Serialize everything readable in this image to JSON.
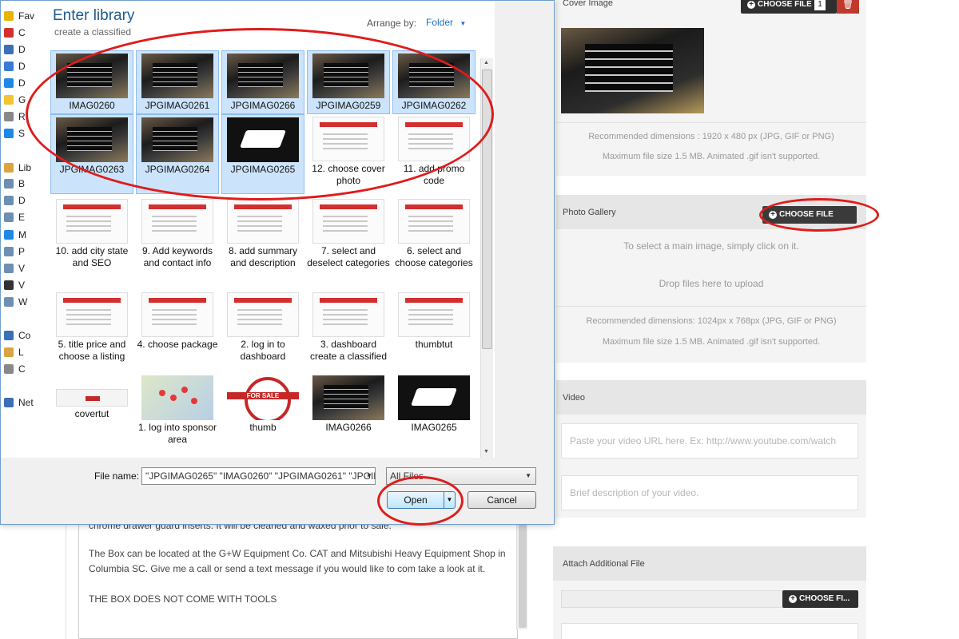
{
  "dialog": {
    "title": "Enter library",
    "subtitle": "create a classified",
    "arrange_label": "Arrange by:",
    "arrange_value": "Folder",
    "file_name_label": "File name:",
    "file_name_value": "\"JPGIMAG0265\" \"IMAG0260\" \"JPGIMAG0261\" \"JPGIM",
    "file_type_value": "All Files",
    "open_label": "Open",
    "cancel_label": "Cancel",
    "files": [
      {
        "label": "IMAG0260",
        "kind": "photo",
        "selected": true
      },
      {
        "label": "JPGIMAG0261",
        "kind": "photo",
        "selected": true
      },
      {
        "label": "JPGIMAG0266",
        "kind": "photo",
        "selected": true
      },
      {
        "label": "JPGIMAG0259",
        "kind": "photo",
        "selected": true
      },
      {
        "label": "JPGIMAG0262",
        "kind": "photo",
        "selected": true
      },
      {
        "label": "JPGIMAG0263",
        "kind": "photo",
        "selected": true
      },
      {
        "label": "JPGIMAG0264",
        "kind": "photo",
        "selected": true
      },
      {
        "label": "JPGIMAG0265",
        "kind": "logo",
        "selected": true
      },
      {
        "label": "12. choose cover photo",
        "kind": "shot",
        "selected": false
      },
      {
        "label": "11. add promo code",
        "kind": "shot",
        "selected": false
      },
      {
        "label": "10. add city state and SEO",
        "kind": "shot",
        "selected": false
      },
      {
        "label": "9. Add keywords and contact info",
        "kind": "shot",
        "selected": false
      },
      {
        "label": "8. add summary and description",
        "kind": "shot",
        "selected": false
      },
      {
        "label": "7. select and deselect categories",
        "kind": "shot",
        "selected": false
      },
      {
        "label": "6. select and choose categories",
        "kind": "shot",
        "selected": false
      },
      {
        "label": "5. title price and choose a listing",
        "kind": "shot",
        "selected": false
      },
      {
        "label": "4. choose package",
        "kind": "shot",
        "selected": false
      },
      {
        "label": "2. log in to dashboard",
        "kind": "shot",
        "selected": false
      },
      {
        "label": "3. dashboard create a classified",
        "kind": "shot",
        "selected": false
      },
      {
        "label": "thumbtut",
        "kind": "shot",
        "selected": false
      },
      {
        "label": "covertut",
        "kind": "wide",
        "selected": false
      },
      {
        "label": "1. log into sponsor area",
        "kind": "map",
        "selected": false
      },
      {
        "label": "thumb",
        "kind": "stamp",
        "selected": false
      },
      {
        "label": "IMAG0266",
        "kind": "photo",
        "selected": false
      },
      {
        "label": "IMAG0265",
        "kind": "logo",
        "selected": false
      }
    ],
    "stamp_text": "FOR SALE"
  },
  "sidebar": {
    "items": [
      {
        "label": "Fav",
        "color": "#e8b400"
      },
      {
        "label": "C",
        "color": "#d32f2f"
      },
      {
        "label": "D",
        "color": "#3b6fb6"
      },
      {
        "label": "D",
        "color": "#3a7bd5"
      },
      {
        "label": "D",
        "color": "#1e88e5"
      },
      {
        "label": "G",
        "color": "#f4c430"
      },
      {
        "label": "R",
        "color": "#888888"
      },
      {
        "label": "S",
        "color": "#1e88e5"
      },
      {
        "label": "Lib",
        "color": "#d9a441"
      },
      {
        "label": "B",
        "color": "#6d8fb3"
      },
      {
        "label": "D",
        "color": "#6d8fb3"
      },
      {
        "label": "E",
        "color": "#6d8fb3"
      },
      {
        "label": "M",
        "color": "#1e88e5"
      },
      {
        "label": "P",
        "color": "#6d8fb3"
      },
      {
        "label": "V",
        "color": "#6d8fb3"
      },
      {
        "label": "V",
        "color": "#333333"
      },
      {
        "label": "W",
        "color": "#6d8fb3"
      },
      {
        "label": "Co",
        "color": "#3b6fb6"
      },
      {
        "label": "L",
        "color": "#d9a441"
      },
      {
        "label": "C",
        "color": "#888888"
      },
      {
        "label": "Net",
        "color": "#3b6fb6"
      }
    ]
  },
  "form": {
    "cover_image_title": "Cover Image",
    "cover_choose_label": "CHOOSE FILE",
    "cover_count": "1",
    "cover_recommended": "Recommended dimensions : 1920 x 480 px (JPG, GIF or PNG)",
    "cover_max": "Maximum file size 1.5 MB. Animated .gif isn't supported.",
    "gallery_title": "Photo Gallery",
    "gallery_choose_label": "CHOOSE FILE",
    "gallery_hint": "To select a main image, simply click on it.",
    "gallery_drop": "Drop files here to upload",
    "gallery_recommended": "Recommended dimensions: 1024px x 768px (JPG, GIF or PNG)",
    "gallery_max": "Maximum file size 1.5 MB. Animated .gif isn't supported.",
    "video_title": "Video",
    "video_url_placeholder": "Paste your video URL here. Ex: http://www.youtube.com/watch",
    "video_desc_placeholder": "Brief description of your video.",
    "attach_title": "Attach Additional File",
    "attach_choose_label": "CHOOSE FI..."
  },
  "description": {
    "partial_line": "chrome drawer guard inserts. It will be cleaned and waxed prior to sale.",
    "paragraph1": "The Box can be located at the G+W Equipment Co. CAT and Mitsubishi Heavy Equipment Shop in Columbia SC. Give me a call or send a text message if you would like to com take a look at it.",
    "paragraph2": "THE BOX DOES NOT COME WITH TOOLS"
  },
  "colors": {
    "accent_red": "#e01b1b",
    "link_blue": "#1e6fc6",
    "dark_button": "#2f2f2f"
  }
}
